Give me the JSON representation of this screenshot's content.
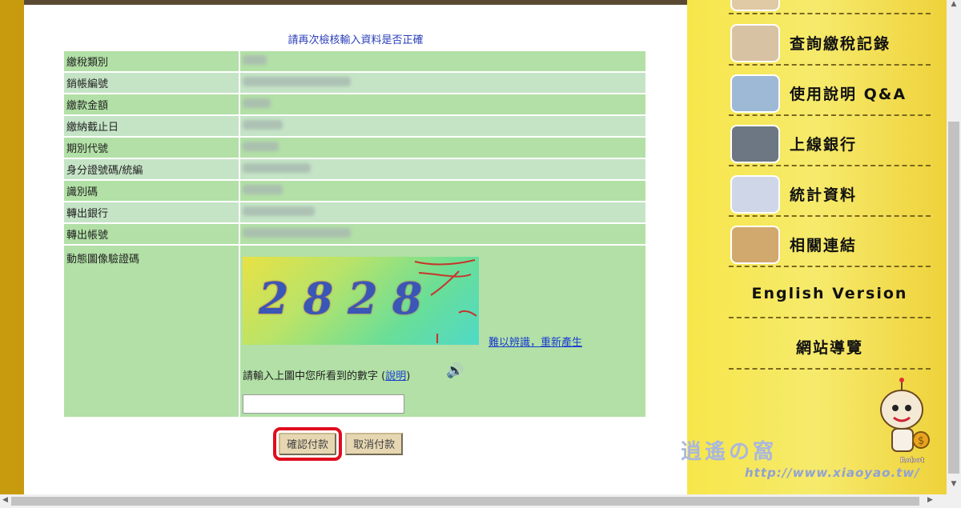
{
  "form": {
    "notice": "請再次檢核輸入資料是否正確",
    "rows": [
      {
        "label": "繳稅類別",
        "blur_len": 30
      },
      {
        "label": "銷帳編號",
        "blur_len": 135
      },
      {
        "label": "繳款金額",
        "blur_len": 35
      },
      {
        "label": "繳納截止日",
        "blur_len": 50
      },
      {
        "label": "期別代號",
        "blur_len": 45
      },
      {
        "label": "身分證號碼/統編",
        "blur_len": 85
      },
      {
        "label": "識別碼",
        "blur_len": 50
      },
      {
        "label": "轉出銀行",
        "blur_len": 90
      },
      {
        "label": "轉出帳號",
        "blur_len": 135
      }
    ],
    "captcha": {
      "label": "動態圖像驗證碼",
      "digits": "2828",
      "regenerate_link": "難以辨識，重新產生",
      "prompt": "請輸入上圖中您所看到的數字",
      "help_open": "(",
      "help_link": "說明",
      "help_close": ")",
      "input_value": ""
    },
    "buttons": {
      "confirm": "確認付款",
      "cancel": "取消付款"
    }
  },
  "sidebar": {
    "items": [
      {
        "label": "查詢繳稅記錄",
        "thumb_color": "#d8c2a4"
      },
      {
        "label": "使用說明 Q&A",
        "thumb_color": "#9db9d6"
      },
      {
        "label": "上線銀行",
        "thumb_color": "#6c7783"
      },
      {
        "label": "統計資料",
        "thumb_color": "#cfd6e8"
      },
      {
        "label": "相關連結",
        "thumb_color": "#d1a86e"
      }
    ],
    "english": "English Version",
    "sitemap": "網站導覽",
    "robot_caption": "Robot"
  },
  "watermark": {
    "title": "逍遙の窩",
    "url": "http://www.xiaoyao.tw/"
  }
}
